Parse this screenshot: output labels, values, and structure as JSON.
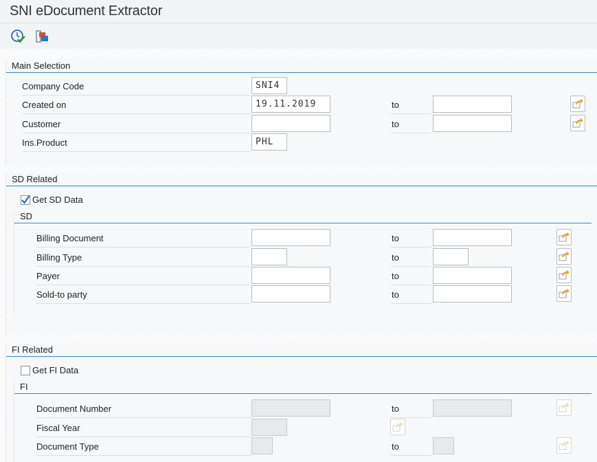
{
  "window": {
    "title": "SNI eDocument Extractor"
  },
  "toolbar": {
    "execute_icon": "execute-clock-icon",
    "variants_icon": "variants-icon"
  },
  "main_selection": {
    "header": "Main Selection",
    "rows": [
      {
        "label": "Company Code",
        "low": "SNI4"
      },
      {
        "label": "Created on",
        "low": "19.11.2019",
        "to": "to",
        "high": ""
      },
      {
        "label": "Customer",
        "low": "",
        "to": "to",
        "high": ""
      },
      {
        "label": "Ins.Product",
        "low": "PHL"
      }
    ]
  },
  "sd_related": {
    "header": "SD Related",
    "checkbox_label": "Get SD Data",
    "checked": true,
    "sub_header": "SD",
    "rows": [
      {
        "label": "Billing Document",
        "low": "",
        "to": "to",
        "high": ""
      },
      {
        "label": "Billing Type",
        "low": "",
        "to": "to",
        "high": ""
      },
      {
        "label": "Payer",
        "low": "",
        "to": "to",
        "high": ""
      },
      {
        "label": "Sold-to party",
        "low": "",
        "to": "to",
        "high": ""
      }
    ]
  },
  "fi_related": {
    "header": "FI Related",
    "checkbox_label": "Get FI Data",
    "checked": false,
    "sub_header": "FI",
    "rows": [
      {
        "label": "Document Number",
        "low": "",
        "to": "to",
        "high": ""
      },
      {
        "label": "Fiscal Year",
        "low": ""
      },
      {
        "label": "Document Type",
        "low": "",
        "to": "to",
        "high": ""
      }
    ]
  },
  "colors": {
    "accent_line": "#2f8fc6",
    "checkmark": "#2a6fb5",
    "multi_select_arrow": "#e8a317"
  }
}
